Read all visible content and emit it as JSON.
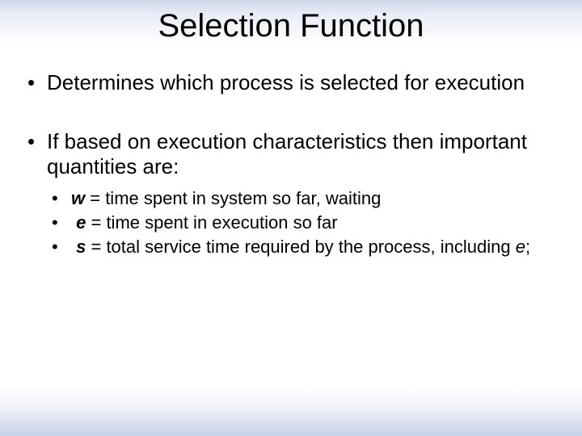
{
  "title": "Selection Function",
  "bullets": {
    "b1": "Determines which process is selected for execution",
    "b2": "If based on execution characteristics then important quantities are:",
    "sub": {
      "s1": {
        "var": "w",
        "text": " = time spent in system so far, waiting"
      },
      "s2": {
        "var": "e",
        "text": " = time spent in execution so far"
      },
      "s3": {
        "var": "s",
        "text_a": " = total service time required by the process, including ",
        "tail_var": "e",
        "tail_punct": ";"
      }
    }
  }
}
